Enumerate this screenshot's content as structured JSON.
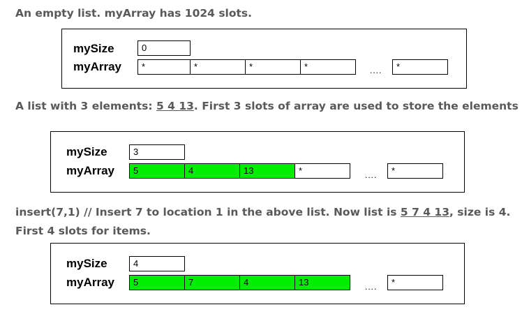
{
  "captions": {
    "c1": "An empty list. myArray has 1024 slots.",
    "c2_pre": "A list with 3 elements: ",
    "c2_link": "5 4 13",
    "c2_post": ". First 3 slots of array are used to store the elements",
    "c3_pre": "insert(7,1) // Insert 7 to location 1 in the above list. Now list is ",
    "c3_link": "5 7 4 13",
    "c3_post": ", size is 4.",
    "c3_line2": "First 4 slots for items."
  },
  "diagrams": [
    {
      "size_label": "mySize",
      "size_value": "0",
      "array_label": "myArray",
      "slots": [
        "*",
        "*",
        "*",
        "*"
      ],
      "used_count": 0,
      "ellipsis": "....",
      "last_slot": "*"
    },
    {
      "size_label": "mySize",
      "size_value": "3",
      "array_label": "myArray",
      "slots": [
        "5",
        "4",
        "13",
        "*"
      ],
      "used_count": 3,
      "ellipsis": "....",
      "last_slot": "*"
    },
    {
      "size_label": "mySize",
      "size_value": "4",
      "array_label": "myArray",
      "slots": [
        "5",
        "7",
        "4",
        "13"
      ],
      "used_count": 4,
      "ellipsis": "....",
      "last_slot": "*"
    }
  ],
  "colors": {
    "used_slot": "#00ee00",
    "caption_text": "#595959"
  }
}
